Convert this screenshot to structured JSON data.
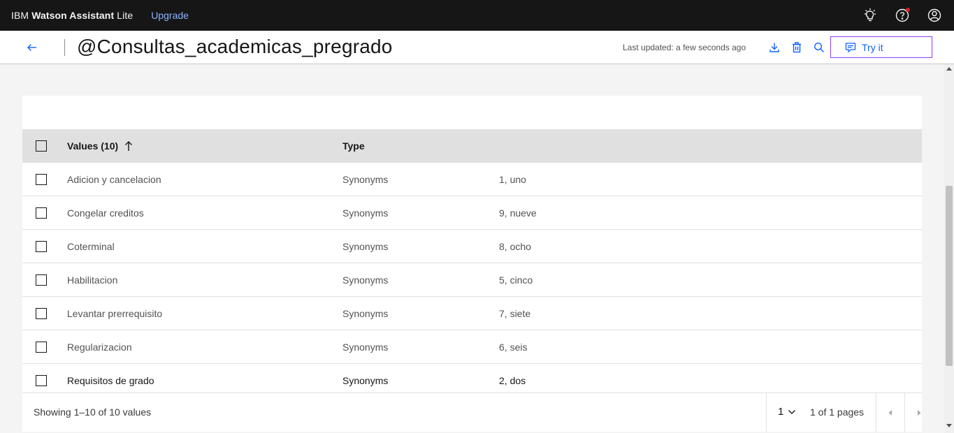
{
  "topbar": {
    "brand_prefix": "IBM",
    "brand_bold": "Watson Assistant",
    "brand_suffix": "Lite",
    "upgrade": "Upgrade",
    "icons": [
      "lightbulb-icon",
      "help-icon",
      "user-avatar-icon"
    ],
    "notification_color": "#da1e28"
  },
  "header": {
    "title": "@Consultas_academicas_pregrado",
    "last_updated": "Last updated: a few seconds ago",
    "try_it": "Try it",
    "icons": [
      "arrow-left-icon",
      "download-icon",
      "trash-icon",
      "search-icon",
      "chat-icon"
    ]
  },
  "table": {
    "col_values": "Values (10)",
    "col_type": "Type",
    "rows": [
      {
        "value": "Adicion y cancelacion",
        "type": "Synonyms",
        "synonyms": "1, uno"
      },
      {
        "value": "Congelar creditos",
        "type": "Synonyms",
        "synonyms": "9, nueve"
      },
      {
        "value": "Coterminal",
        "type": "Synonyms",
        "synonyms": "8, ocho"
      },
      {
        "value": "Habilitacion",
        "type": "Synonyms",
        "synonyms": "5, cinco"
      },
      {
        "value": "Levantar prerrequisito",
        "type": "Synonyms",
        "synonyms": "7, siete"
      },
      {
        "value": "Regularizacion",
        "type": "Synonyms",
        "synonyms": "6, seis"
      },
      {
        "value": "Requisitos de grado",
        "type": "Synonyms",
        "synonyms": "2, dos"
      }
    ]
  },
  "pagination": {
    "showing": "Showing 1–10 of 10 values",
    "page": "1",
    "pages_of": "1 of 1 pages"
  },
  "colors": {
    "accent": "#0f62fe",
    "try_it_border": "#8a3ffc",
    "topbar_bg": "#161616",
    "header_row_bg": "#e0e0e0"
  }
}
